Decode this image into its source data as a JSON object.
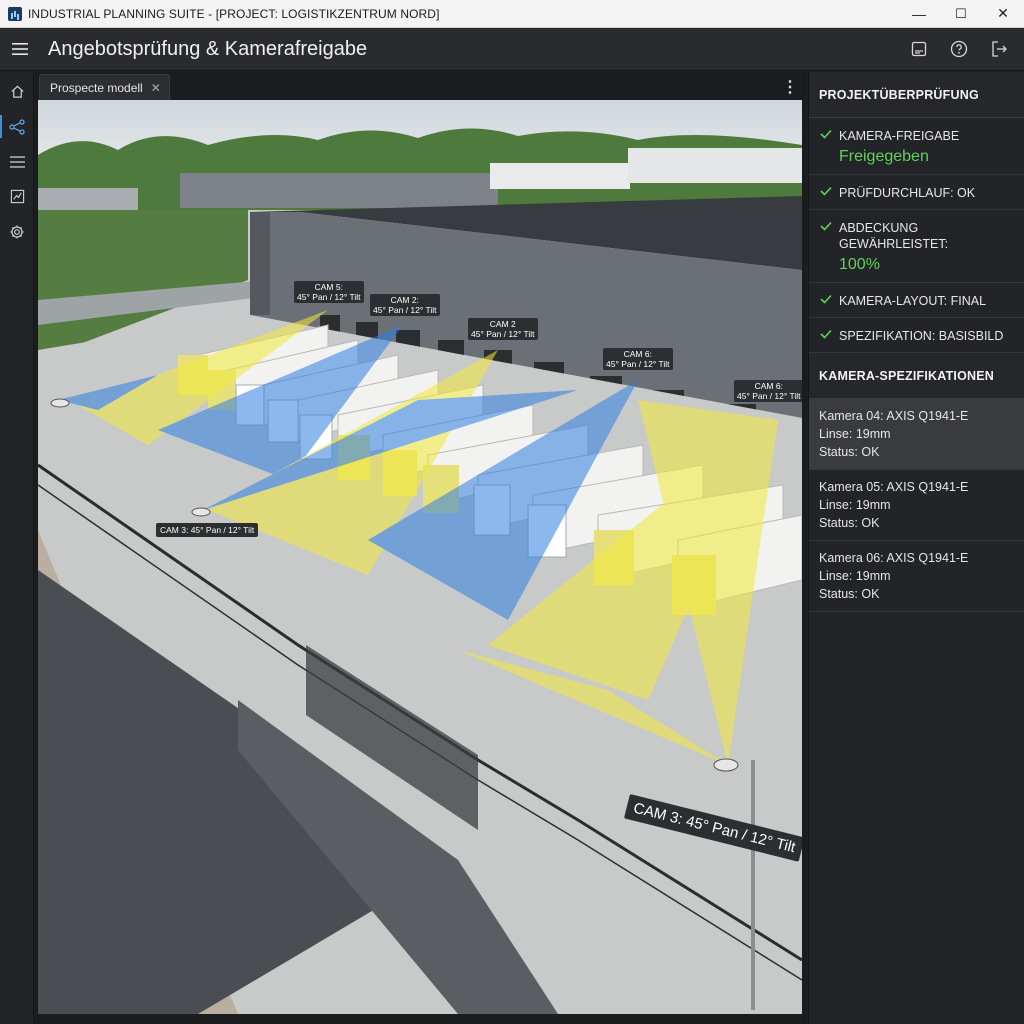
{
  "window": {
    "title": "INDUSTRIAL PLANNING SUITE - [PROJECT: LOGISTIKZENTRUM NORD]",
    "minimize": "—",
    "maximize": "☐",
    "close": "✕"
  },
  "header": {
    "title": "Angebotsprüfung & Kamerafreigabe",
    "actions": [
      "report-icon",
      "help-icon",
      "logout-icon"
    ]
  },
  "rail": {
    "items": [
      "home-icon",
      "share-nodes-icon",
      "list-icon",
      "chart-icon",
      "settings-icon"
    ],
    "active_index": 1
  },
  "viewport": {
    "tab_label": "Prospecte modell",
    "tab_close": "✕",
    "menu": "⋮",
    "camera_labels": [
      "CAM 5:\n45° Pan / 12° Tilt",
      "CAM 2:\n45° Pan / 12° Tilt",
      "CAM 2\n45° Pan / 12° Tilt",
      "CAM 6:\n45° Pan / 12° Tilt",
      "CAM 6:\n45° Pan / 12° Tilt",
      "CAM 3: 45° Pan / 12° Tilt",
      "CAM 3: 45° Pan / 12° Tilt"
    ]
  },
  "panel": {
    "review_heading": "PROJEKTÜBERPRÜFUNG",
    "checks": [
      {
        "label": "KAMERA-FREIGABE",
        "value": "Freigegeben"
      },
      {
        "label": "PRÜFDURCHLAUF: OK",
        "value": ""
      },
      {
        "label": "ABDECKUNG GEWÄHRLEISTET:",
        "value": "100%"
      },
      {
        "label": "KAMERA-LAYOUT: FINAL",
        "value": ""
      },
      {
        "label": "SPEZIFIKATION: BASISBILD",
        "value": ""
      }
    ],
    "specs_heading": "KAMERA-SPEZIFIKATIONEN",
    "specs": [
      {
        "line1": "Kamera 04: AXIS Q1941-E",
        "line2": "Linse: 19mm",
        "line3": "Status: OK"
      },
      {
        "line1": "Kamera 05: AXIS Q1941-E",
        "line2": "Linse: 19mm",
        "line3": "Status: OK"
      },
      {
        "line1": "Kamera 06: AXIS Q1941-E",
        "line2": "Linse: 19mm",
        "line3": "Status: OK"
      }
    ],
    "selected_spec": 0
  },
  "colors": {
    "accent": "#3b8fe0",
    "ok_green": "#5fd35a",
    "fov_yellow": "#f2ea3a",
    "fov_blue": "#2f7fe0"
  }
}
